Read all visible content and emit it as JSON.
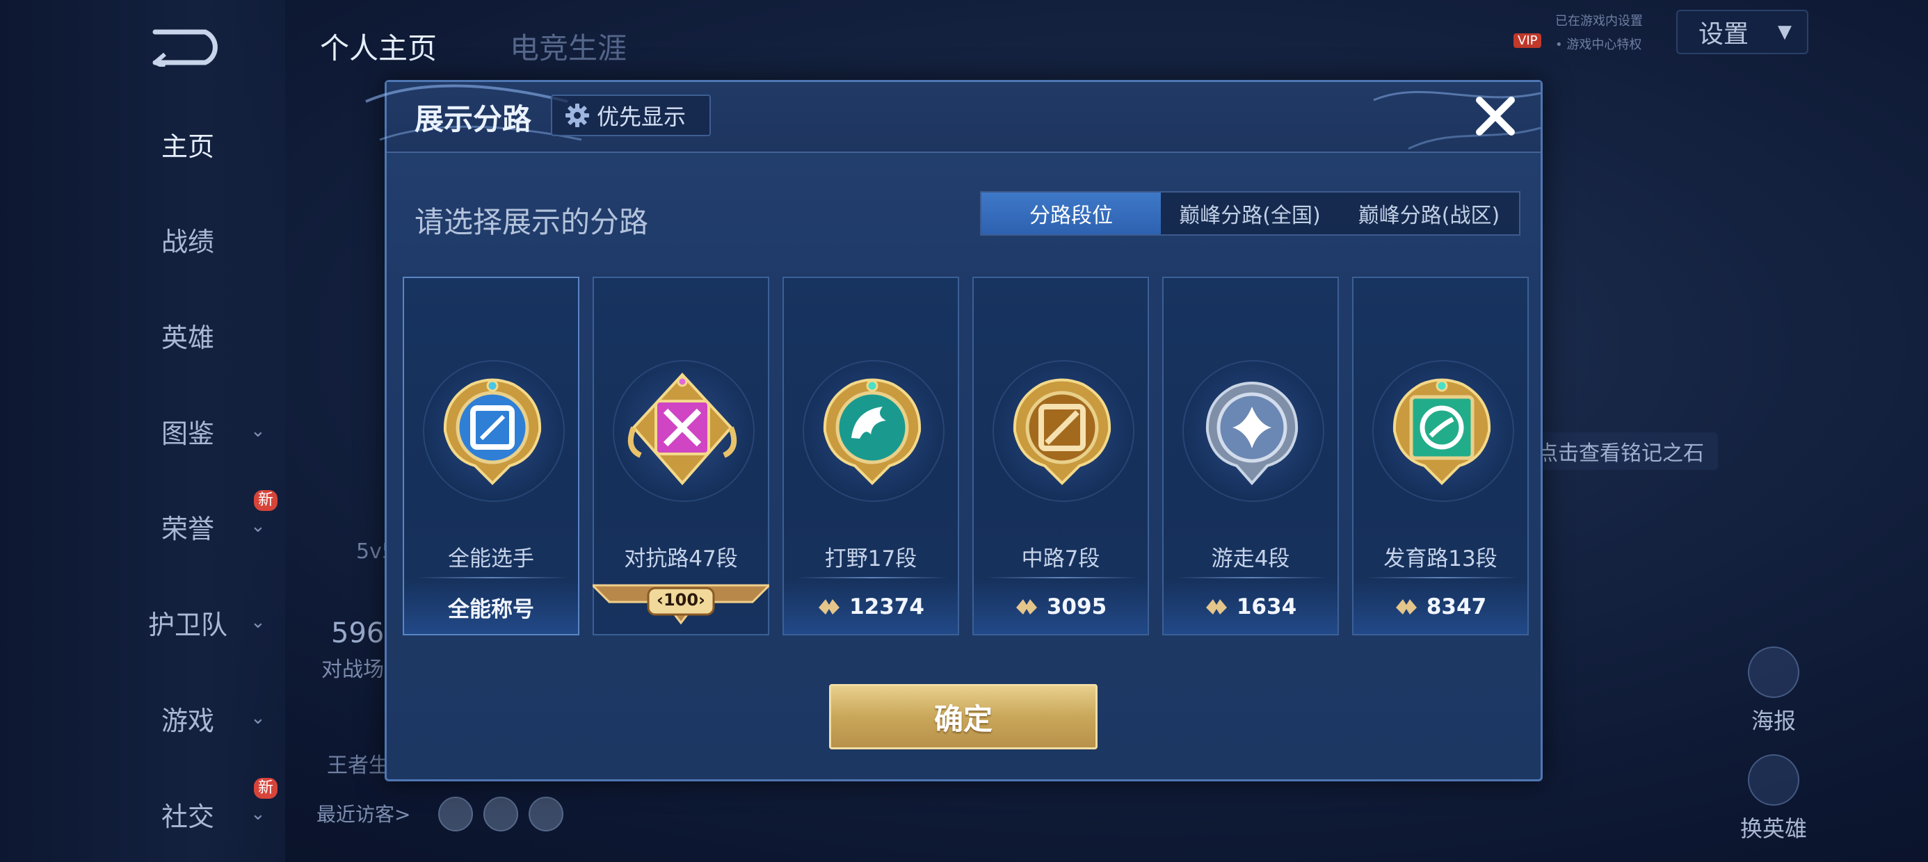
{
  "background": {
    "top_tabs": [
      "个人主页",
      "电竞生涯"
    ],
    "sidebar": {
      "items": [
        {
          "label": "主页",
          "active": true
        },
        {
          "label": "战绩"
        },
        {
          "label": "英雄"
        },
        {
          "label": "图鉴"
        },
        {
          "label": "荣誉",
          "badge": "新"
        },
        {
          "label": "护卫队"
        },
        {
          "label": "游戏"
        },
        {
          "label": "社交",
          "badge": "新"
        }
      ]
    },
    "settings_label": "设置",
    "vip_label": "VIP",
    "vip_line1": "已在游戏内设置",
    "vip_line2": "• 游戏中心特权",
    "stone_text": "点击查看铭记之石",
    "poster_label": "海报",
    "change_hero_label": "换英雄",
    "stat_partial": "596",
    "stat_partial_label": "对战场",
    "mode_partial": "5v5",
    "king_partial": "王者生",
    "recent_visitors_label": "最近访客>"
  },
  "modal": {
    "title": "展示分路",
    "priority_button": "优先显示",
    "subtitle": "请选择展示的分路",
    "tabs": [
      {
        "label": "分路段位",
        "active": true
      },
      {
        "label": "巅峰分路(全国)"
      },
      {
        "label": "巅峰分路(战区)"
      }
    ],
    "cards": [
      {
        "name": "全能选手",
        "footer": "全能称号",
        "emblem": "all-round-emblem",
        "color": "#3f8fe0"
      },
      {
        "name": "对抗路47段",
        "ribbon": "100",
        "emblem": "clash-lane-emblem",
        "color": "#d64fc8"
      },
      {
        "name": "打野17段",
        "score": "12374",
        "emblem": "jungle-emblem",
        "color": "#1fa39a"
      },
      {
        "name": "中路7段",
        "score": "3095",
        "emblem": "mid-lane-emblem",
        "color": "#c98a2a"
      },
      {
        "name": "游走4段",
        "score": "1634",
        "emblem": "roam-emblem",
        "color": "#7d9cc4"
      },
      {
        "name": "发育路13段",
        "score": "8347",
        "emblem": "farm-lane-emblem",
        "color": "#23b08c"
      }
    ],
    "confirm_button": "确定"
  }
}
